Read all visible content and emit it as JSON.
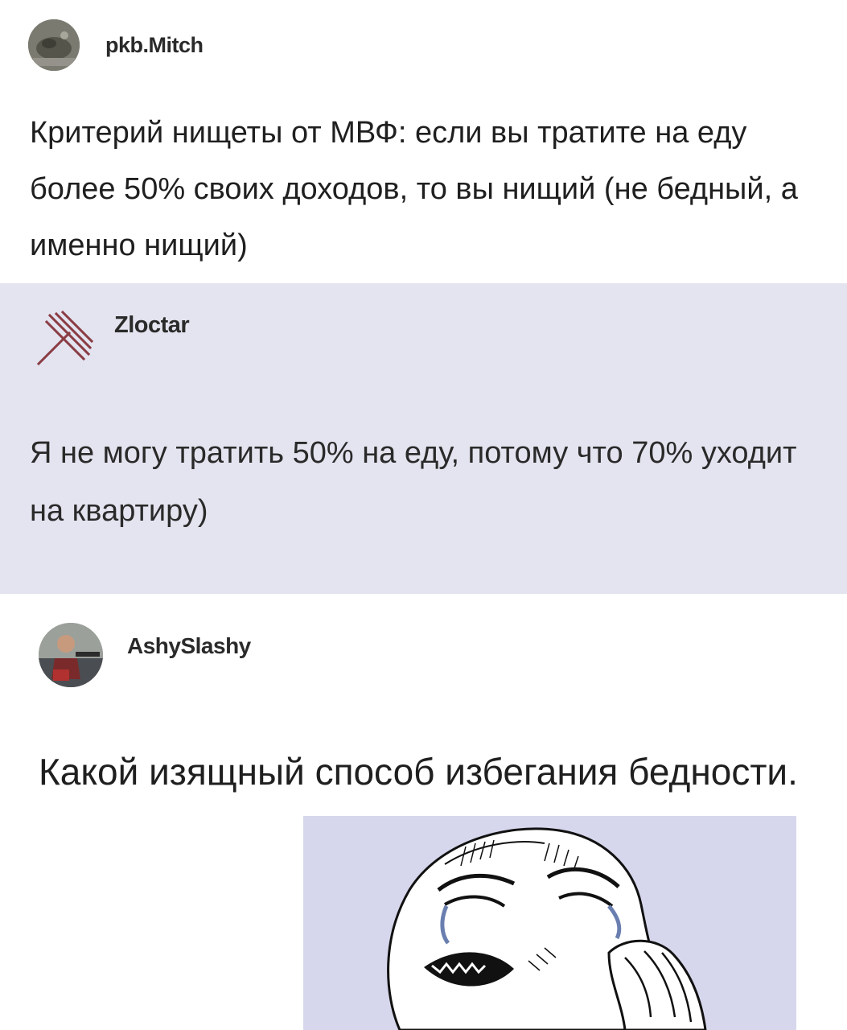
{
  "posts": [
    {
      "author": "pkb.Mitch",
      "avatar_icon": "user-avatar-photo",
      "text": "Критерий нищеты от МВФ: если вы тратите на еду более 50% своих доходов, то вы нищий (не бедный, а именно нищий)"
    },
    {
      "author": "Zloctar",
      "avatar_icon": "diagonal-lines-logo-icon",
      "text": "Я не могу тратить 50% на еду, потому что  70% уходит на квартиру)"
    },
    {
      "author": "AshySlashy",
      "avatar_icon": "user-avatar-photo",
      "text": "Какой изящный способ избегания бедности.",
      "image": "crying-meme-face"
    }
  ],
  "colors": {
    "quoted_post_background": "#e3e4ef",
    "meme_background": "#d6d7ec",
    "logo_accent": "#8a3c44"
  }
}
